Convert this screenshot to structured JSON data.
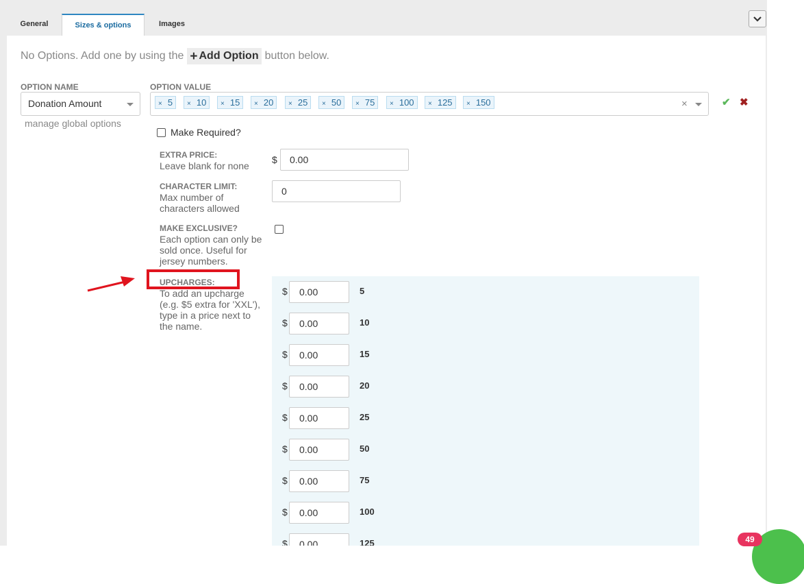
{
  "tabs": [
    {
      "label": "General"
    },
    {
      "label": "Sizes & options"
    },
    {
      "label": "Images"
    }
  ],
  "notice": {
    "prefix": "No Options. Add one by using the",
    "add_button_label": "Add Option",
    "suffix": "button below."
  },
  "option_name": {
    "label": "OPTION NAME",
    "value": "Donation Amount",
    "manage_link": "manage global options"
  },
  "option_value": {
    "label": "OPTION VALUE",
    "tags": [
      "5",
      "10",
      "15",
      "20",
      "25",
      "50",
      "75",
      "100",
      "125",
      "150"
    ]
  },
  "make_required": {
    "label": "Make Required?",
    "checked": false
  },
  "extra_price": {
    "title": "EXTRA PRICE:",
    "desc": "Leave blank for none",
    "currency": "$",
    "value": "0.00"
  },
  "character_limit": {
    "title": "CHARACTER LIMIT:",
    "desc1": "Max number of",
    "desc2": "characters allowed",
    "value": "0"
  },
  "make_exclusive": {
    "title": "MAKE EXCLUSIVE?",
    "desc1": "Each option can only be",
    "desc2": "sold once. Useful for",
    "desc3": "jersey numbers.",
    "checked": false
  },
  "upcharges": {
    "title": "UPCHARGES:",
    "desc1": "To add an upcharge",
    "desc2": "(e.g. $5 extra for 'XXL'),",
    "desc3": "type in a price next to",
    "desc4": "the name.",
    "currency": "$",
    "rows": [
      {
        "value": "0.00",
        "name": "5"
      },
      {
        "value": "0.00",
        "name": "10"
      },
      {
        "value": "0.00",
        "name": "15"
      },
      {
        "value": "0.00",
        "name": "20"
      },
      {
        "value": "0.00",
        "name": "25"
      },
      {
        "value": "0.00",
        "name": "50"
      },
      {
        "value": "0.00",
        "name": "75"
      },
      {
        "value": "0.00",
        "name": "100"
      },
      {
        "value": "0.00",
        "name": "125"
      }
    ]
  },
  "chat_badge": {
    "count": "49"
  },
  "colors": {
    "highlight": "#e0141e",
    "tag_bg": "#eaf4fb",
    "upcharge_bg": "#eef7fa",
    "accept": "#5cb85c",
    "reject": "#a02020",
    "badge": "#e8335f",
    "chat": "#4cc04c"
  }
}
